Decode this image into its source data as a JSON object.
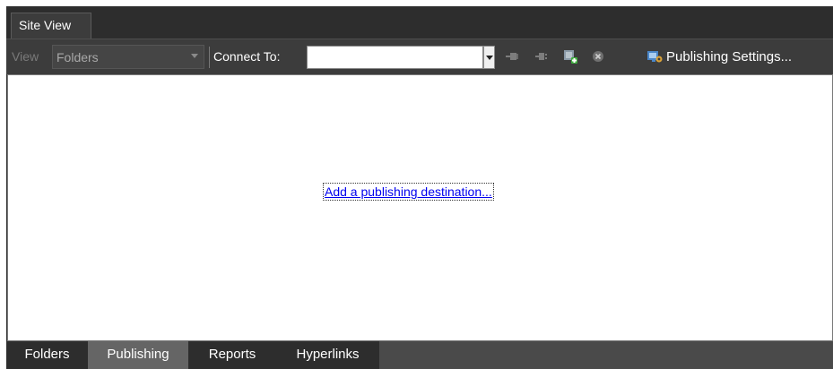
{
  "tabs": {
    "site_view": "Site View"
  },
  "toolbar": {
    "view_label": "View",
    "view_value": "Folders",
    "connect_label": "Connect To:",
    "connect_value": "",
    "icons": [
      "connect-icon",
      "disconnect-icon",
      "new-destination-icon",
      "remove-destination-icon",
      "publishing-settings-icon"
    ],
    "publishing_settings_label": "Publishing Settings..."
  },
  "content": {
    "add_destination_link": "Add a publishing destination..."
  },
  "bottom_tabs": {
    "items": [
      {
        "label": "Folders",
        "active": false
      },
      {
        "label": "Publishing",
        "active": true
      },
      {
        "label": "Reports",
        "active": false
      },
      {
        "label": "Hyperlinks",
        "active": false
      }
    ]
  },
  "colors": {
    "chrome_dark": "#2d2d2d",
    "toolbar": "#3c3c3c",
    "active_bottom_tab": "#656565",
    "link": "#0000ee"
  }
}
